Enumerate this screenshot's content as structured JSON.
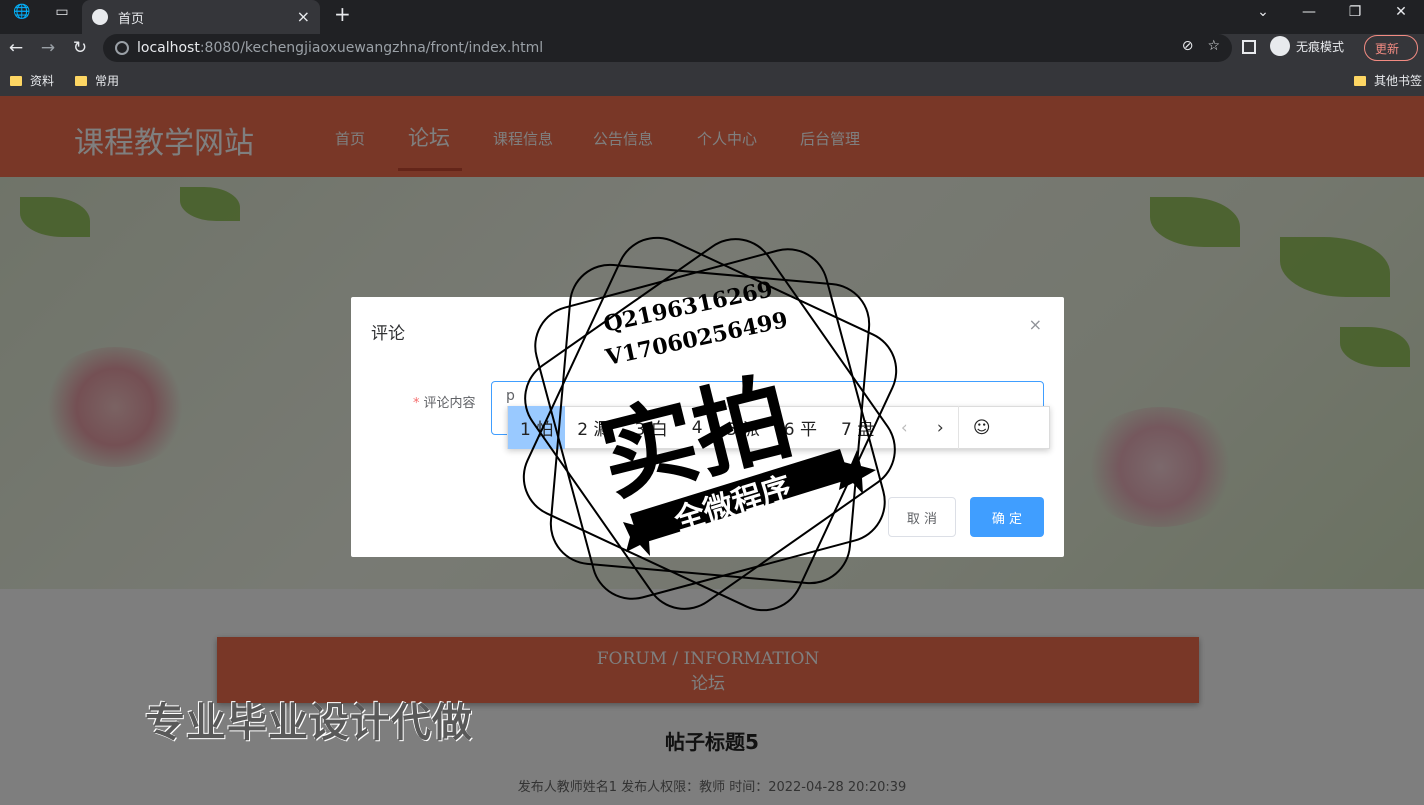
{
  "browser": {
    "tab_title": "首页",
    "url_host": "localhost",
    "url_path": ":8080/kechengjiaoxuewangzhna/front/index.html",
    "incognito_label": "无痕模式",
    "update_label": "更新",
    "bookmarks": [
      "资料",
      "常用"
    ],
    "other_bookmarks": "其他书签"
  },
  "site": {
    "brand": "课程教学网站",
    "nav": [
      "首页",
      "论坛",
      "课程信息",
      "公告信息",
      "个人中心",
      "后台管理"
    ],
    "active_nav": "论坛"
  },
  "forum": {
    "title_en": "FORUM / INFORMATION",
    "title_cn": "论坛",
    "post_title": "帖子标题5",
    "post_meta": "发布人教师姓名1   发布人权限：教师   时间：2022-04-28 20:20:39"
  },
  "dialog": {
    "title": "评论",
    "close": "×",
    "field_label": "评论内容",
    "required_mark": "*",
    "textarea_value": "p",
    "cancel_label": "取 消",
    "ok_label": "确 定"
  },
  "ime": {
    "candidates": [
      "1 怕",
      "2 漏",
      "3 白",
      "4",
      "5 派",
      "6 平",
      "7 盘"
    ],
    "selected_index": 0
  },
  "watermark": {
    "stamp_line1": "Q2196316269",
    "stamp_line2": "V17060256499",
    "stamp_big": "实拍",
    "stamp_ribbon": "全微程序",
    "caption": "专业毕业设计代做"
  },
  "colors": {
    "header": "#f26e4f",
    "primary_button": "#409eff"
  }
}
